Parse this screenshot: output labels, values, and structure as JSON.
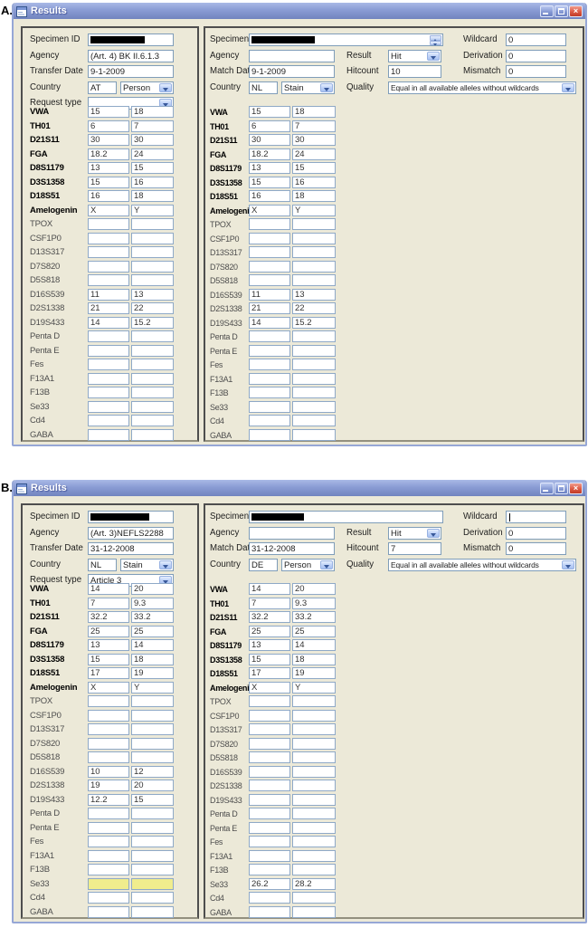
{
  "figure_labels": {
    "a": "A.",
    "b": "B."
  },
  "icons": {
    "close_glyph": "×"
  },
  "colors": {
    "window_bg": "#ece9d8",
    "titlebar_blue": "#8a9cd4",
    "close_red": "#dc5943",
    "field_border": "#7f9db9",
    "panel_border": "#4e4e4e",
    "highlight_yellow": "#f0ed8d"
  },
  "windows": [
    {
      "figure_label": "A.",
      "title": "Results",
      "left": {
        "specimen_id_label": "Specimen ID",
        "agency_label": "Agency",
        "agency_value": "(Art. 4) BK II.6.1.3",
        "date_label": "Transfer Date",
        "date_value": "9-1-2009",
        "country_label": "Country",
        "country_code": "AT",
        "country_kind": "Person",
        "request_type_label": "Request type",
        "request_type_value": ""
      },
      "middle": {
        "specimen_id_label": "Specimen ID",
        "agency_label": "Agency",
        "agency_value": "",
        "date_label": "Match Date",
        "date_value": "9-1-2009",
        "country_label": "Country",
        "country_code": "NL",
        "country_kind": "Stain"
      },
      "match_info": {
        "result_label": "Result",
        "result_value": "Hit",
        "hitcount_label": "Hitcount",
        "hitcount_value": "10",
        "quality_label": "Quality",
        "quality_value": "Equal in all available alleles without wildcards",
        "wildcard_label": "Wildcard",
        "wildcard_value": "0",
        "derivation_label": "Derivation",
        "derivation_value": "0",
        "mismatch_label": "Mismatch",
        "mismatch_value": "0"
      },
      "loci": [
        {
          "name": "VWA",
          "bold": true,
          "left": [
            "15",
            "18"
          ],
          "match": [
            "15",
            "18"
          ]
        },
        {
          "name": "TH01",
          "bold": true,
          "left": [
            "6",
            "7"
          ],
          "match": [
            "6",
            "7"
          ]
        },
        {
          "name": "D21S11",
          "bold": true,
          "left": [
            "30",
            "30"
          ],
          "match": [
            "30",
            "30"
          ]
        },
        {
          "name": "FGA",
          "bold": true,
          "left": [
            "18.2",
            "24"
          ],
          "match": [
            "18.2",
            "24"
          ]
        },
        {
          "name": "D8S1179",
          "bold": true,
          "left": [
            "13",
            "15"
          ],
          "match": [
            "13",
            "15"
          ]
        },
        {
          "name": "D3S1358",
          "bold": true,
          "left": [
            "15",
            "16"
          ],
          "match": [
            "15",
            "16"
          ]
        },
        {
          "name": "D18S51",
          "bold": true,
          "left": [
            "16",
            "18"
          ],
          "match": [
            "16",
            "18"
          ]
        },
        {
          "name": "Amelogenin",
          "bold": true,
          "left": [
            "X",
            "Y"
          ],
          "match": [
            "X",
            "Y"
          ]
        },
        {
          "name": "TPOX",
          "bold": false,
          "left": [],
          "match": []
        },
        {
          "name": "CSF1P0",
          "bold": false,
          "left": [],
          "match": []
        },
        {
          "name": "D13S317",
          "bold": false,
          "left": [],
          "match": []
        },
        {
          "name": "D7S820",
          "bold": false,
          "left": [],
          "match": []
        },
        {
          "name": "D5S818",
          "bold": false,
          "left": [],
          "match": []
        },
        {
          "name": "D16S539",
          "bold": false,
          "left": [
            "11",
            "13"
          ],
          "match": [
            "11",
            "13"
          ]
        },
        {
          "name": "D2S1338",
          "bold": false,
          "left": [
            "21",
            "22"
          ],
          "match": [
            "21",
            "22"
          ]
        },
        {
          "name": "D19S433",
          "bold": false,
          "left": [
            "14",
            "15.2"
          ],
          "match": [
            "14",
            "15.2"
          ]
        },
        {
          "name": "Penta D",
          "bold": false,
          "left": [],
          "match": []
        },
        {
          "name": "Penta E",
          "bold": false,
          "left": [],
          "match": []
        },
        {
          "name": "Fes",
          "bold": false,
          "left": [],
          "match": []
        },
        {
          "name": "F13A1",
          "bold": false,
          "left": [],
          "match": []
        },
        {
          "name": "F13B",
          "bold": false,
          "left": [],
          "match": []
        },
        {
          "name": "Se33",
          "bold": false,
          "left": [],
          "match": []
        },
        {
          "name": "Cd4",
          "bold": false,
          "left": [],
          "match": []
        },
        {
          "name": "GABA",
          "bold": false,
          "left": [],
          "match": []
        }
      ]
    },
    {
      "figure_label": "B.",
      "title": "Results",
      "left": {
        "specimen_id_label": "Specimen ID",
        "agency_label": "Agency",
        "agency_value": "(Art. 3)NEFLS2288",
        "date_label": "Transfer Date",
        "date_value": "31-12-2008",
        "country_label": "Country",
        "country_code": "NL",
        "country_kind": "Stain",
        "request_type_label": "Request type",
        "request_type_value": "Article 3"
      },
      "middle": {
        "specimen_id_label": "Specimen ID",
        "agency_label": "Agency",
        "agency_value": "",
        "date_label": "Match Date",
        "date_value": "31-12-2008",
        "country_label": "Country",
        "country_code": "DE",
        "country_kind": "Person"
      },
      "match_info": {
        "result_label": "Result",
        "result_value": "Hit",
        "hitcount_label": "Hitcount",
        "hitcount_value": "7",
        "quality_label": "Quality",
        "quality_value": "Equal in all available alleles without wildcards",
        "wildcard_label": "Wildcard",
        "wildcard_value": "",
        "derivation_label": "Derivation",
        "derivation_value": "0",
        "mismatch_label": "Mismatch",
        "mismatch_value": "0"
      },
      "loci": [
        {
          "name": "VWA",
          "bold": true,
          "left": [
            "14",
            "20"
          ],
          "match": [
            "14",
            "20"
          ]
        },
        {
          "name": "TH01",
          "bold": true,
          "left": [
            "7",
            "9.3"
          ],
          "match": [
            "7",
            "9.3"
          ]
        },
        {
          "name": "D21S11",
          "bold": true,
          "left": [
            "32.2",
            "33.2"
          ],
          "match": [
            "32.2",
            "33.2"
          ]
        },
        {
          "name": "FGA",
          "bold": true,
          "left": [
            "25",
            "25"
          ],
          "match": [
            "25",
            "25"
          ]
        },
        {
          "name": "D8S1179",
          "bold": true,
          "left": [
            "13",
            "14"
          ],
          "match": [
            "13",
            "14"
          ]
        },
        {
          "name": "D3S1358",
          "bold": true,
          "left": [
            "15",
            "18"
          ],
          "match": [
            "15",
            "18"
          ]
        },
        {
          "name": "D18S51",
          "bold": true,
          "left": [
            "17",
            "19"
          ],
          "match": [
            "17",
            "19"
          ]
        },
        {
          "name": "Amelogenin",
          "bold": true,
          "left": [
            "X",
            "Y"
          ],
          "match": [
            "X",
            "Y"
          ]
        },
        {
          "name": "TPOX",
          "bold": false,
          "left": [],
          "match": []
        },
        {
          "name": "CSF1P0",
          "bold": false,
          "left": [],
          "match": []
        },
        {
          "name": "D13S317",
          "bold": false,
          "left": [],
          "match": []
        },
        {
          "name": "D7S820",
          "bold": false,
          "left": [],
          "match": []
        },
        {
          "name": "D5S818",
          "bold": false,
          "left": [],
          "match": []
        },
        {
          "name": "D16S539",
          "bold": false,
          "left": [
            "10",
            "12"
          ],
          "match": []
        },
        {
          "name": "D2S1338",
          "bold": false,
          "left": [
            "19",
            "20"
          ],
          "match": []
        },
        {
          "name": "D19S433",
          "bold": false,
          "left": [
            "12.2",
            "15"
          ],
          "match": []
        },
        {
          "name": "Penta D",
          "bold": false,
          "left": [],
          "match": []
        },
        {
          "name": "Penta E",
          "bold": false,
          "left": [],
          "match": []
        },
        {
          "name": "Fes",
          "bold": false,
          "left": [],
          "match": []
        },
        {
          "name": "F13A1",
          "bold": false,
          "left": [],
          "match": []
        },
        {
          "name": "F13B",
          "bold": false,
          "left": [],
          "match": []
        },
        {
          "name": "Se33",
          "bold": false,
          "left": [],
          "left_highlight": true,
          "match": [
            "26.2",
            "28.2"
          ]
        },
        {
          "name": "Cd4",
          "bold": false,
          "left": [],
          "match": []
        },
        {
          "name": "GABA",
          "bold": false,
          "left": [],
          "match": []
        }
      ]
    }
  ]
}
